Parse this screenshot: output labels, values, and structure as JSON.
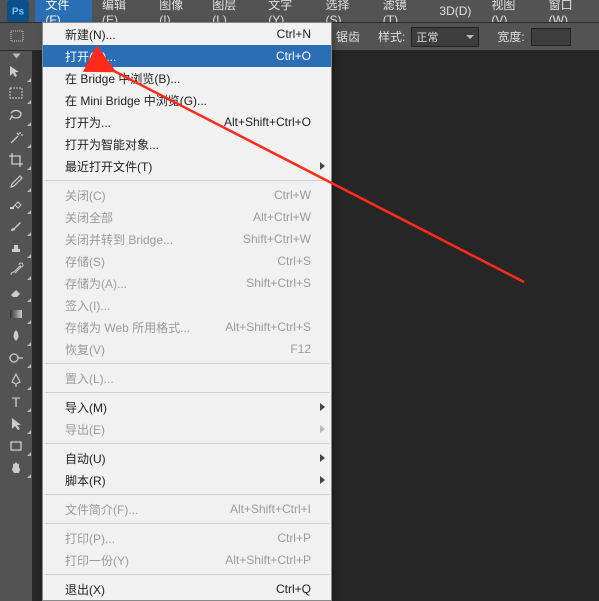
{
  "menubar": {
    "items": [
      {
        "label": "文件(F)"
      },
      {
        "label": "编辑(E)"
      },
      {
        "label": "图像(I)"
      },
      {
        "label": "图层(L)"
      },
      {
        "label": "文字(Y)"
      },
      {
        "label": "选择(S)"
      },
      {
        "label": "滤镜(T)"
      },
      {
        "label": "3D(D)"
      },
      {
        "label": "视图(V)"
      },
      {
        "label": "窗口(W)"
      }
    ]
  },
  "options": {
    "fragment_label": "锯齿",
    "style_label": "样式:",
    "style_value": "正常",
    "width_label": "宽度:"
  },
  "dropdown": {
    "items": [
      {
        "label": "新建(N)...",
        "shortcut": "Ctrl+N"
      },
      {
        "label": "打开(O)...",
        "shortcut": "Ctrl+O",
        "highlight": true
      },
      {
        "label": "在 Bridge 中浏览(B)...",
        "shortcut": ""
      },
      {
        "label": "在 Mini Bridge 中浏览(G)...",
        "shortcut": ""
      },
      {
        "label": "打开为...",
        "shortcut": "Alt+Shift+Ctrl+O"
      },
      {
        "label": "打开为智能对象...",
        "shortcut": ""
      },
      {
        "label": "最近打开文件(T)",
        "shortcut": "",
        "submenu": true
      },
      {
        "sep": true
      },
      {
        "label": "关闭(C)",
        "shortcut": "Ctrl+W",
        "disabled": true
      },
      {
        "label": "关闭全部",
        "shortcut": "Alt+Ctrl+W",
        "disabled": true
      },
      {
        "label": "关闭并转到 Bridge...",
        "shortcut": "Shift+Ctrl+W",
        "disabled": true
      },
      {
        "label": "存储(S)",
        "shortcut": "Ctrl+S",
        "disabled": true
      },
      {
        "label": "存储为(A)...",
        "shortcut": "Shift+Ctrl+S",
        "disabled": true
      },
      {
        "label": "签入(I)...",
        "shortcut": "",
        "disabled": true
      },
      {
        "label": "存储为 Web 所用格式...",
        "shortcut": "Alt+Shift+Ctrl+S",
        "disabled": true
      },
      {
        "label": "恢复(V)",
        "shortcut": "F12",
        "disabled": true
      },
      {
        "sep": true
      },
      {
        "label": "置入(L)...",
        "shortcut": "",
        "disabled": true
      },
      {
        "sep": true
      },
      {
        "label": "导入(M)",
        "shortcut": "",
        "submenu": true
      },
      {
        "label": "导出(E)",
        "shortcut": "",
        "submenu": true,
        "disabled": true
      },
      {
        "sep": true
      },
      {
        "label": "自动(U)",
        "shortcut": "",
        "submenu": true
      },
      {
        "label": "脚本(R)",
        "shortcut": "",
        "submenu": true
      },
      {
        "sep": true
      },
      {
        "label": "文件简介(F)...",
        "shortcut": "Alt+Shift+Ctrl+I",
        "disabled": true
      },
      {
        "sep": true
      },
      {
        "label": "打印(P)...",
        "shortcut": "Ctrl+P",
        "disabled": true
      },
      {
        "label": "打印一份(Y)",
        "shortcut": "Alt+Shift+Ctrl+P",
        "disabled": true
      },
      {
        "sep": true
      },
      {
        "label": "退出(X)",
        "shortcut": "Ctrl+Q"
      }
    ]
  }
}
